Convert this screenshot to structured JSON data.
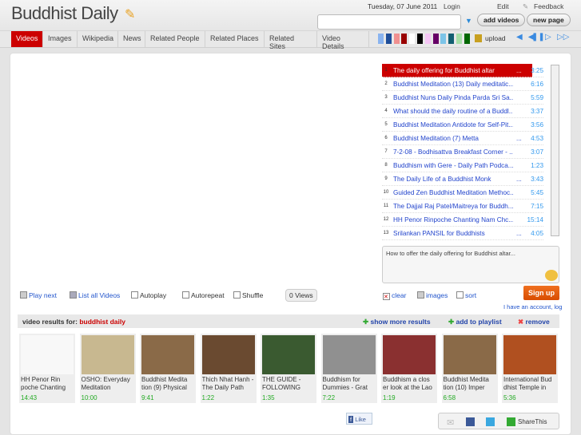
{
  "header": {
    "title": "Buddhist Daily",
    "date": "Tuesday, 07 June 2011",
    "login": "Login",
    "edit": "Edit",
    "feedback": "Feedback",
    "search_value": "",
    "add_videos": "add videos",
    "new_page": "new page"
  },
  "tabs": [
    "Videos",
    "Images",
    "Wikipedia",
    "News",
    "Related People",
    "Related Places",
    "Related Sites",
    "Video Details"
  ],
  "swatches": [
    "#8ab4f0",
    "#1f4e99",
    "#f09090",
    "#990000",
    "#ffffff",
    "#000000",
    "#f5c6f5",
    "#660066",
    "#7cc4e8",
    "#135f72",
    "#a8e0a8",
    "#006600"
  ],
  "upload": "upload",
  "playlist": [
    {
      "n": "1",
      "title": "The daily offering for Buddhist altar",
      "dur": "3:25",
      "ell": "..."
    },
    {
      "n": "2",
      "title": "Buddhist Meditation (13) Daily meditatic...",
      "dur": "6:16",
      "ell": ""
    },
    {
      "n": "3",
      "title": "Buddhist Nuns Daily Pinda Parda Sri Sa...",
      "dur": "5:59",
      "ell": ""
    },
    {
      "n": "4",
      "title": "What should the daily routine of a Buddl...",
      "dur": "3:37",
      "ell": ""
    },
    {
      "n": "5",
      "title": "Buddhist Meditation Antidote for Self-Pit...",
      "dur": "3:56",
      "ell": ""
    },
    {
      "n": "6",
      "title": "Buddhist Meditation (7) Metta",
      "dur": "4:53",
      "ell": "..."
    },
    {
      "n": "7",
      "title": "7-2-08 - Bodhisattva Breakfast Corner - ...",
      "dur": "3:07",
      "ell": ""
    },
    {
      "n": "8",
      "title": "Buddhism with Gere - Daily Path Podca...",
      "dur": "1:23",
      "ell": ""
    },
    {
      "n": "9",
      "title": "The Daily Life of a Buddhist Monk",
      "dur": "3:43",
      "ell": "..."
    },
    {
      "n": "10",
      "title": "Guided Zen Buddhist Meditation Methoc...",
      "dur": "5:45",
      "ell": ""
    },
    {
      "n": "11",
      "title": "The Dajjal Raj Patel/Maitreya for Buddh...",
      "dur": "7:15",
      "ell": ""
    },
    {
      "n": "12",
      "title": "HH Penor Rinpoche Chanting Nam Chc...",
      "dur": "15:14",
      "ell": ""
    },
    {
      "n": "13",
      "title": "Srilankan PANSIL for Buddhists",
      "dur": "4:05",
      "ell": "..."
    }
  ],
  "description": "How to offer the daily offering for Buddhist altar...",
  "controls": {
    "play_next": "Play next",
    "list_all": "List all Videos",
    "autoplay": "Autoplay",
    "autorepeat": "Autorepeat",
    "shuffle": "Shuffle",
    "views": "0 Views",
    "clear": "clear",
    "images": "images",
    "sort": "sort",
    "signup": "Sign up",
    "have_account": "I have an account, log"
  },
  "results": {
    "label": "video results for:",
    "query": "buddhist daily",
    "show_more": "show more results",
    "add_playlist": "add to playlist",
    "remove": "remove"
  },
  "thumbs": [
    {
      "title": "HH Penor Rin poche Chanting",
      "dur": "14:43",
      "color": "#f8f8f8"
    },
    {
      "title": "OSHO: Everyday Meditation",
      "dur": "10:00",
      "color": "#c8b890"
    },
    {
      "title": "Buddhist Medita tion (9) Physical",
      "dur": "9:41",
      "color": "#8a6a48"
    },
    {
      "title": "Thich Nhat Hanh - The Daily Path",
      "dur": "1:22",
      "color": "#6a4a30"
    },
    {
      "title": "THE GUIDE - FOLLOWING",
      "dur": "1:35",
      "color": "#3a5a30"
    },
    {
      "title": "Buddhism for Dummies - Grat",
      "dur": "7:22",
      "color": "#909090"
    },
    {
      "title": "Buddhism a clos er look at the Lao",
      "dur": "1:19",
      "color": "#8a3030"
    },
    {
      "title": "Buddhist Medita tion (10) Imper",
      "dur": "6:58",
      "color": "#8a6a48"
    },
    {
      "title": "International Bud dhist Temple in",
      "dur": "5:36",
      "color": "#b05020"
    }
  ],
  "footer": {
    "like": "Like",
    "sharethis": "ShareThis"
  }
}
